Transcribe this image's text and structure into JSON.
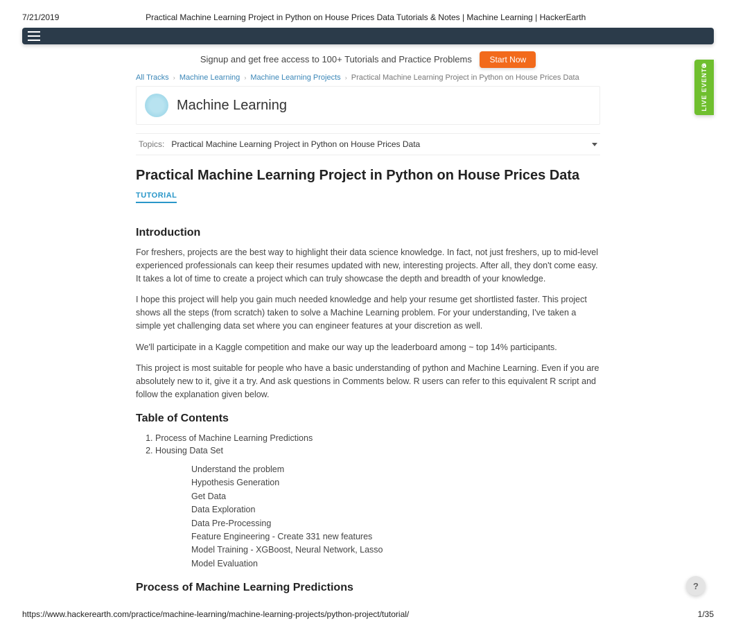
{
  "print": {
    "date": "7/21/2019",
    "title": "Practical Machine Learning Project in Python on House Prices Data Tutorials & Notes | Machine Learning | HackerEarth",
    "url": "https://www.hackerearth.com/practice/machine-learning/machine-learning-projects/python-project/tutorial/",
    "page": "1/35"
  },
  "signup": {
    "text": "Signup and get free access to 100+ Tutorials and Practice Problems",
    "cta": "Start Now"
  },
  "live_tab": {
    "badge": "5",
    "label": "LIVE EVENTS"
  },
  "help": {
    "label": "?"
  },
  "breadcrumb": {
    "items": [
      {
        "label": "All Tracks"
      },
      {
        "label": "Machine Learning"
      },
      {
        "label": "Machine Learning Projects"
      }
    ],
    "current": "Practical Machine Learning Project in Python on House Prices Data"
  },
  "card": {
    "title": "Machine Learning"
  },
  "topics": {
    "label": "Topics:",
    "value": "Practical Machine Learning Project in Python on House Prices Data"
  },
  "article": {
    "title": "Practical Machine Learning Project in Python on House Prices Data",
    "badge": "TUTORIAL",
    "sections": {
      "intro_h": "Introduction",
      "p1": "For freshers, projects are the best way to highlight their data science knowledge. In fact, not just freshers, up to mid-level experienced professionals can keep their resumes updated with new, interesting projects. After all, they don't come easy. It takes a lot of time to create a project which can truly showcase the depth and breadth of your knowledge.",
      "p2": "I hope this project will help you gain much needed knowledge and help your resume get shortlisted faster. This project shows all the steps (from scratch) taken to solve a Machine Learning problem. For your understanding, I've taken a simple yet challenging data set where you can engineer features at your discretion as well.",
      "p3": "We'll participate in a Kaggle competition and make our way up the leaderboard among ~ top 14% participants.",
      "p4": "This project is most suitable for people who have a basic understanding of python and Machine Learning. Even if you are absolutely new to it, give it a try. And ask questions in Comments below. R users can refer to this equivalent R script and follow the explanation given below.",
      "toc_h": "Table of Contents",
      "toc": [
        "Process of Machine Learning Predictions",
        "Housing Data Set"
      ],
      "sub": [
        "Understand the problem",
        "Hypothesis Generation",
        "Get Data",
        "Data Exploration",
        "Data Pre-Processing",
        "Feature Engineering - Create 331 new features",
        "Model Training - XGBoost, Neural Network, Lasso",
        "Model Evaluation"
      ],
      "process_h": "Process of Machine Learning Predictions"
    }
  }
}
